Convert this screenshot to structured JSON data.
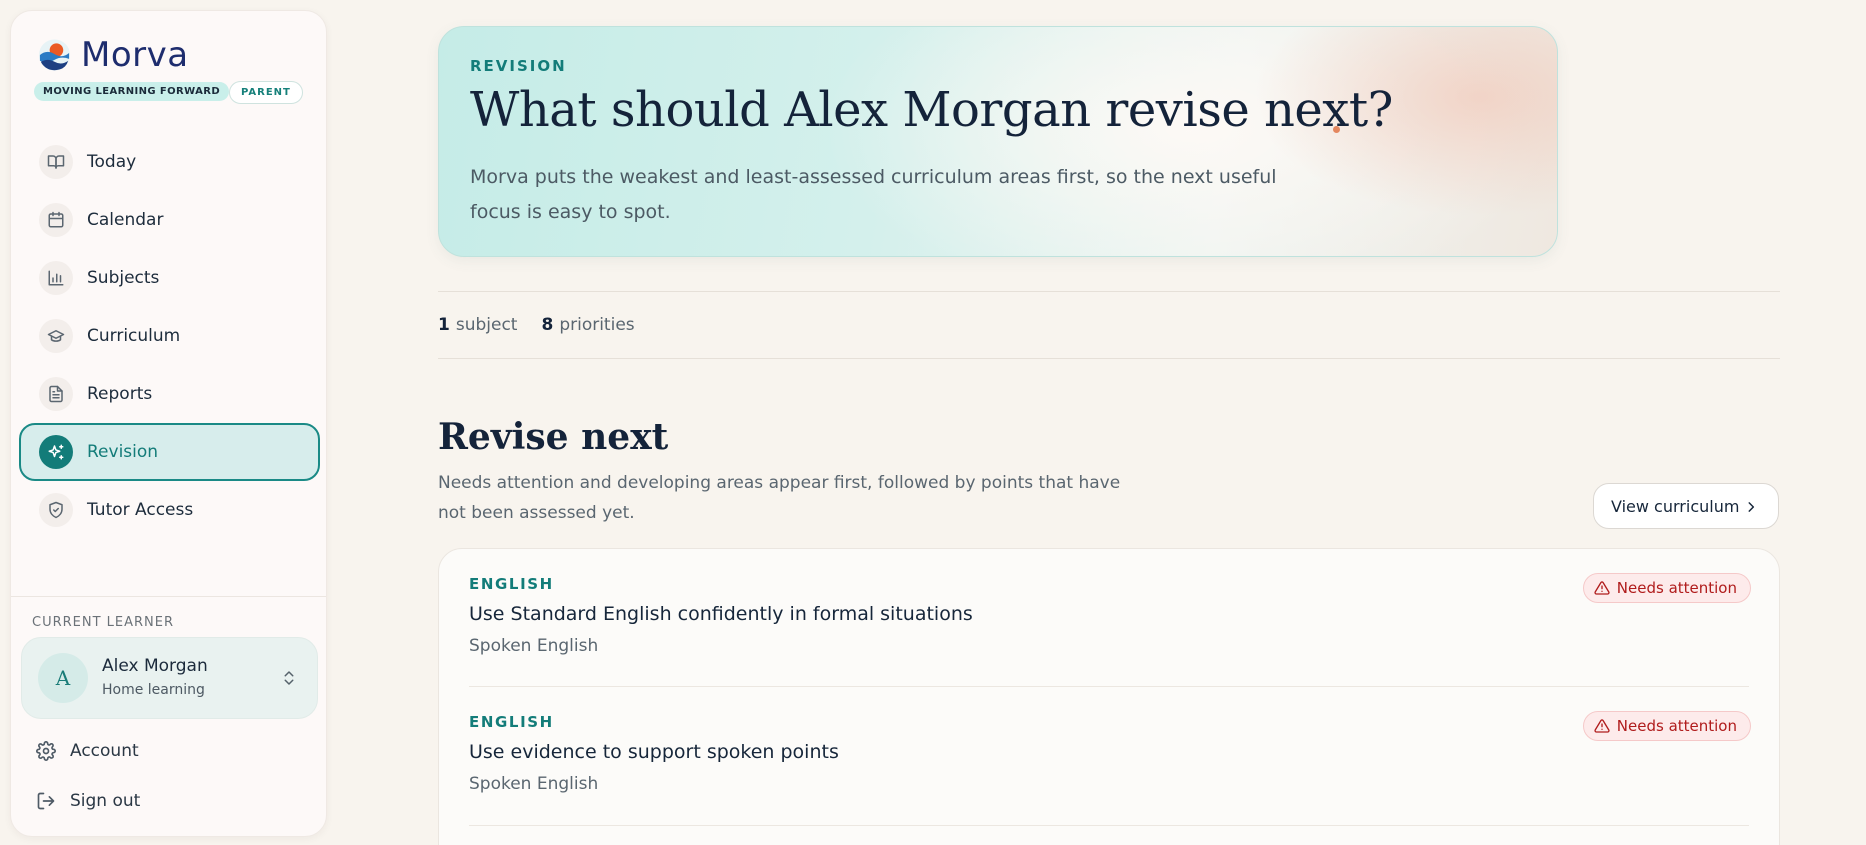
{
  "app": {
    "name": "Morva",
    "tagline": "MOVING LEARNING FORWARD",
    "role": "PARENT"
  },
  "sidebar": {
    "items": [
      {
        "label": "Today",
        "icon": "book-open-icon"
      },
      {
        "label": "Calendar",
        "icon": "calendar-icon"
      },
      {
        "label": "Subjects",
        "icon": "bar-chart-icon"
      },
      {
        "label": "Curriculum",
        "icon": "graduation-cap-icon"
      },
      {
        "label": "Reports",
        "icon": "document-icon"
      },
      {
        "label": "Revision",
        "icon": "sparkles-icon",
        "active": true
      },
      {
        "label": "Tutor Access",
        "icon": "shield-check-icon"
      }
    ],
    "current_learner_label": "CURRENT LEARNER",
    "learner": {
      "initial": "A",
      "name": "Alex Morgan",
      "subtitle": "Home learning"
    },
    "account_label": "Account",
    "signout_label": "Sign out"
  },
  "hero": {
    "eyebrow": "REVISION",
    "title": "What should Alex Morgan revise next?",
    "description": "Morva puts the weakest and least-assessed curriculum areas first, so the next useful focus is easy to spot."
  },
  "stats": {
    "subjects_count": "1",
    "subjects_label": "subject",
    "priorities_count": "8",
    "priorities_label": "priorities"
  },
  "revise_next": {
    "title": "Revise next",
    "description": "Needs attention and developing areas appear first, followed by points that have not been assessed yet.",
    "view_button": "View curriculum",
    "items": [
      {
        "subject": "ENGLISH",
        "title": "Use Standard English confidently in formal situations",
        "strand": "Spoken English",
        "status": "Needs attention"
      },
      {
        "subject": "ENGLISH",
        "title": "Use evidence to support spoken points",
        "strand": "Spoken English",
        "status": "Needs attention"
      }
    ]
  },
  "colors": {
    "accent": "#137c79",
    "brand": "#1e2d6e",
    "attention": "#b01c1c",
    "background": "#f8f4ee"
  }
}
